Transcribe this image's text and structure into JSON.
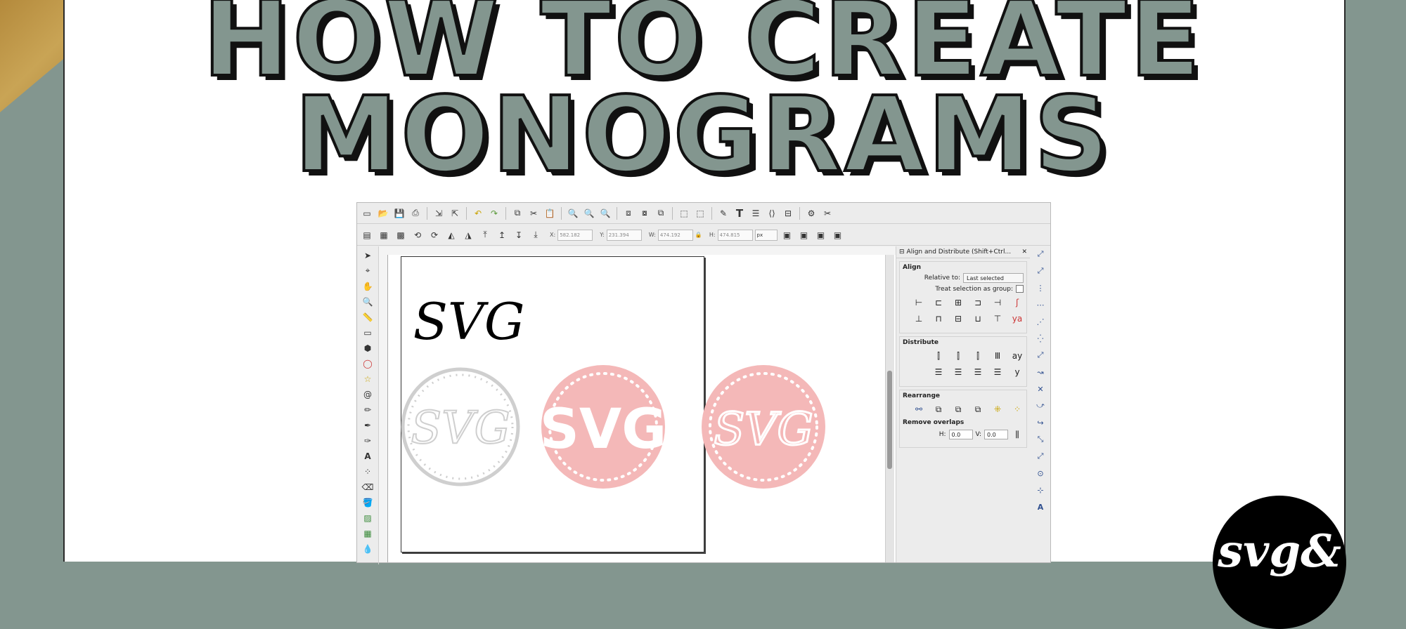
{
  "headline": {
    "line1": "HOW TO CREATE",
    "line2": "MONOGRAMS"
  },
  "colors": {
    "background": "#83968f",
    "card": "#ffffff",
    "title_fill": "#83968f",
    "title_outline": "#111111",
    "monogram_pink": "#f4b8b8",
    "monogram_gray": "#cfcfcf"
  },
  "app": {
    "toolbar": {
      "icons": [
        "new-document-icon",
        "open-icon",
        "save-icon",
        "print-icon",
        "import-icon",
        "export-icon",
        "undo-icon",
        "redo-icon",
        "duplicate-icon",
        "cut-icon",
        "paste-icon",
        "zoom-selection-icon",
        "zoom-drawing-icon",
        "zoom-page-icon",
        "group-icon",
        "ungroup-icon",
        "clone-icon",
        "node-editor-icon",
        "transform-icon",
        "fill-stroke-icon",
        "text-tool-icon",
        "layers-icon",
        "xml-editor-icon",
        "align-icon",
        "preferences-icon",
        "document-properties-icon"
      ]
    },
    "controls": {
      "x_label": "X:",
      "x_value": "582.182",
      "y_label": "Y:",
      "y_value": "231.394",
      "w_label": "W:",
      "w_value": "474.192",
      "h_label": "H:",
      "h_value": "474.815",
      "unit": "px"
    },
    "canvas": {
      "monograms": [
        {
          "name": "black-script-monogram",
          "text": "SVG",
          "color": "#000000"
        },
        {
          "name": "gray-circle-monogram",
          "text": "SVG",
          "color": "#cfcfcf"
        },
        {
          "name": "pink-block-monogram",
          "text": "SVG",
          "color": "#f4b8b8"
        },
        {
          "name": "pink-script-monogram",
          "text": "SVG",
          "color": "#f4b8b8"
        }
      ]
    },
    "panel": {
      "title": "Align and Distribute (Shift+Ctrl...",
      "align_title": "Align",
      "relative_label": "Relative to:",
      "relative_value": "Last selected",
      "treat_group_label": "Treat selection as group:",
      "distribute_title": "Distribute",
      "rearrange_title": "Rearrange",
      "remove_overlaps_title": "Remove overlaps",
      "h_label": "H:",
      "h_value": "0.0",
      "v_label": "V:",
      "v_value": "0.0"
    }
  },
  "logo": {
    "text": "svg&"
  }
}
